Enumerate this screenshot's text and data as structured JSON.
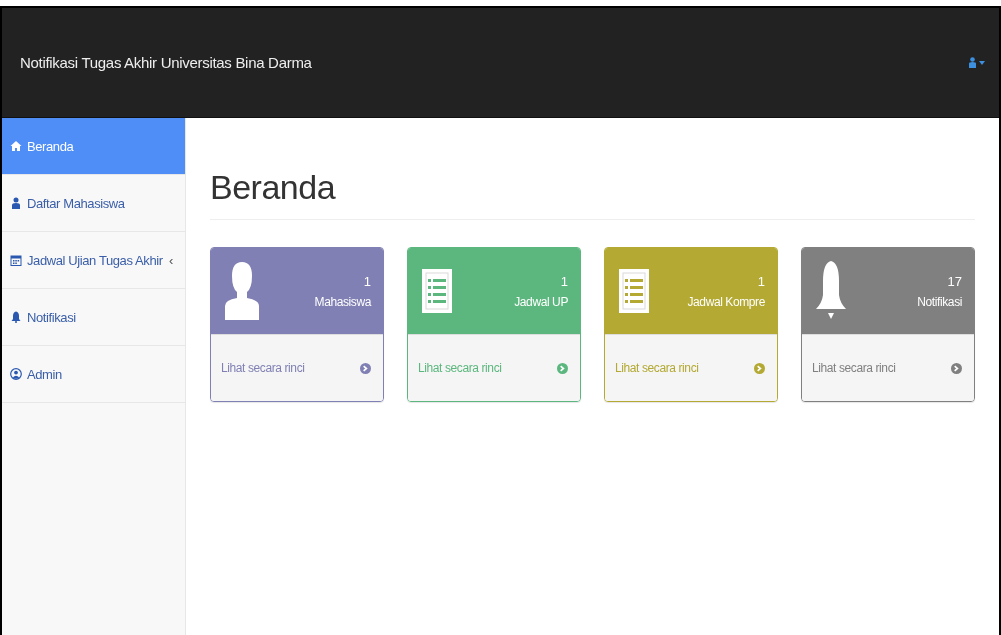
{
  "navbar": {
    "brand": "Notifikasi Tugas Akhir Universitas Bina Darma"
  },
  "sidebar": {
    "items": [
      {
        "kind": "home",
        "label": "Beranda",
        "selected": true
      },
      {
        "kind": "user",
        "label": "Daftar Mahasiswa",
        "selected": false
      },
      {
        "kind": "calendar",
        "label": "Jadwal Ujian Tugas Akhir",
        "selected": false,
        "caret": "‹"
      },
      {
        "kind": "bell",
        "label": "Notifikasi",
        "selected": false
      },
      {
        "kind": "admin",
        "label": "Admin",
        "selected": false
      }
    ]
  },
  "page": {
    "heading": "Beranda"
  },
  "panels": [
    {
      "kind": "user",
      "count": "1",
      "label": "Mahasiswa",
      "link": "Lihat secara rinci",
      "color": "#8080b4"
    },
    {
      "kind": "list",
      "count": "1",
      "label": "Jadwal UP",
      "link": "Lihat secara rinci",
      "color": "#5cb77f"
    },
    {
      "kind": "list",
      "count": "1",
      "label": "Jadwal Kompre",
      "link": "Lihat secara rinci",
      "color": "#b3a933"
    },
    {
      "kind": "bell",
      "count": "17",
      "label": "Notifikasi",
      "link": "Lihat secara rinci",
      "color": "#808080"
    }
  ]
}
